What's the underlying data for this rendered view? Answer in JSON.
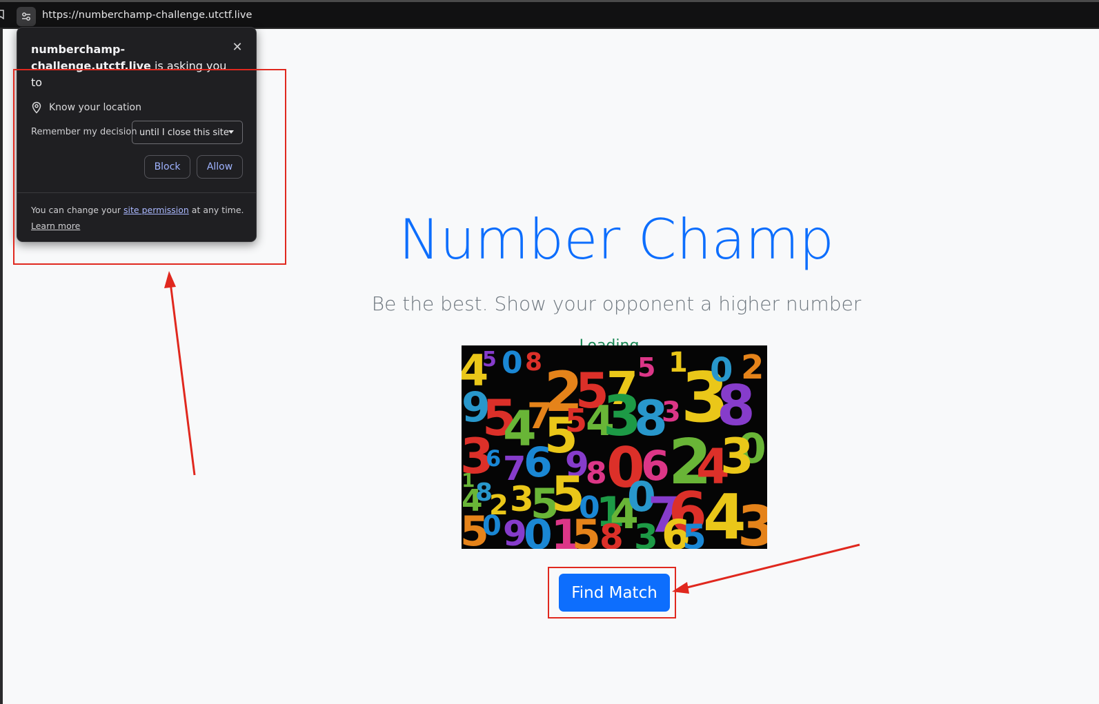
{
  "browser": {
    "url": "https://numberchamp-challenge.utctf.live"
  },
  "page": {
    "title": "Number Champ",
    "subtitle": "Be the best. Show your opponent a higher number",
    "status": "Loading...",
    "find_match_label": "Find Match"
  },
  "permission_prompt": {
    "host": "numberchamp-challenge.utctf.live",
    "heading_rest": " is asking you to",
    "permission": "Know your location",
    "remember_label": "Remember my decision",
    "remember_value": "until I close this site",
    "block_label": "Block",
    "allow_label": "Allow",
    "footer_prefix": "You can change your ",
    "footer_link": "site permission",
    "footer_suffix": " at any time.",
    "learn_more": "Learn more"
  },
  "colors": {
    "primary": "#0d6efd",
    "success": "#198754",
    "muted": "#6c757d",
    "annotation": "#e0281e"
  }
}
